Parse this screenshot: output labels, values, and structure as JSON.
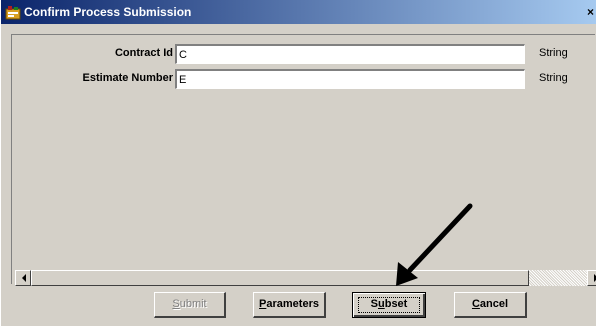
{
  "window": {
    "title": "Confirm Process Submission",
    "close_glyph": "×",
    "icon": "app-icon"
  },
  "fields": [
    {
      "label": "Contract Id",
      "value": "C",
      "type": "String"
    },
    {
      "label": "Estimate Number",
      "value": "E",
      "type": "String"
    }
  ],
  "buttons": {
    "submit": {
      "mnemonic": "S",
      "rest": "ubmit",
      "enabled": false
    },
    "parameters": {
      "mnemonic": "P",
      "rest": "arameters",
      "enabled": true
    },
    "subset": {
      "pre": "S",
      "mnemonic": "u",
      "rest": "bset",
      "enabled": true,
      "default": true
    },
    "cancel": {
      "mnemonic": "C",
      "rest": "ancel",
      "enabled": true
    }
  },
  "annotation": {
    "icon": "pointer-arrow-icon",
    "color": "#000000"
  },
  "colors": {
    "title_start": "#0a246a",
    "title_end": "#a6caf0",
    "face": "#d4d0c8"
  }
}
